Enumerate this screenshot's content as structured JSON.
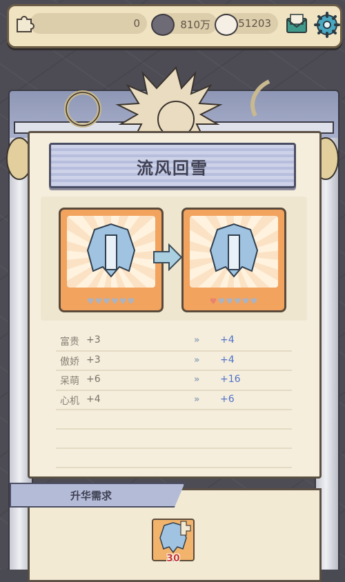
{
  "topbar": {
    "puzzle_count": "0",
    "currency_a": "810万",
    "currency_b": "51203"
  },
  "panel": {
    "title": "流风回雪",
    "from_hearts": "♥♥♥♥♥♥",
    "to_hearts": "♥♥♥♥♥♥",
    "stats": [
      {
        "name": "富贵",
        "value": "+3",
        "new": "+4"
      },
      {
        "name": "傲娇",
        "value": "+3",
        "new": "+4"
      },
      {
        "name": "呆萌",
        "value": "+6",
        "new": "+16"
      },
      {
        "name": "心机",
        "value": "+4",
        "new": "+6"
      }
    ],
    "arrow_glyph": "»"
  },
  "requirement": {
    "label": "升华需求",
    "item_count": "30"
  },
  "colors": {
    "accent_blue": "#4f71c8",
    "card_orange": "#f2a35e",
    "banner_lavender": "#b7bedd"
  }
}
